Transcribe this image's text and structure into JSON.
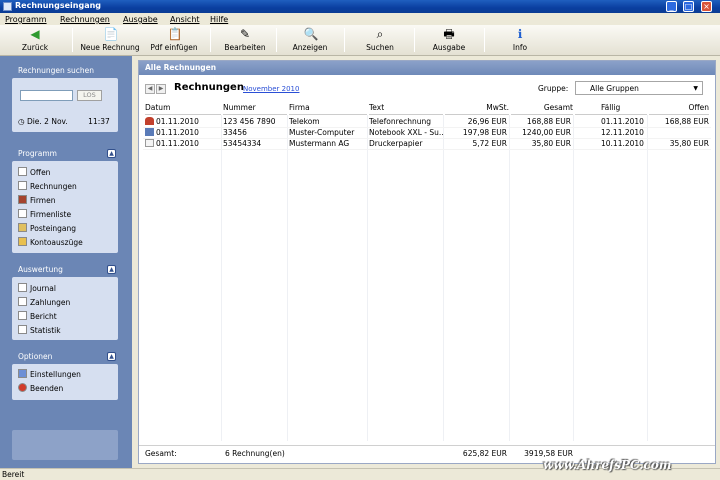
{
  "window": {
    "title": "Rechnungseingang",
    "min": "_",
    "max": "□",
    "close": "×"
  },
  "menu": [
    "Programm",
    "Rechnungen",
    "Ausgabe",
    "Ansicht",
    "Hilfe"
  ],
  "toolbar": [
    {
      "label": "Zurück",
      "icon": "back-arrow-icon",
      "glyph": "◀"
    },
    {
      "label": "Neue Rechnung",
      "icon": "new-invoice-icon",
      "glyph": "📄"
    },
    {
      "label": "Pdf einfügen",
      "icon": "paste-pdf-icon",
      "glyph": "📋"
    },
    {
      "label": "Bearbeiten",
      "icon": "edit-icon",
      "glyph": "✎"
    },
    {
      "label": "Anzeigen",
      "icon": "view-icon",
      "glyph": "🔍"
    },
    {
      "label": "Suchen",
      "icon": "search-icon",
      "glyph": "⌕"
    },
    {
      "label": "Ausgabe",
      "icon": "printer-icon",
      "glyph": "🖶"
    },
    {
      "label": "Info",
      "icon": "info-icon",
      "glyph": "ℹ"
    }
  ],
  "sidebar": {
    "search": {
      "title": "Rechnungen suchen",
      "button": "LOS",
      "date": "Die. 2 Nov.",
      "time": "11:37"
    },
    "programm": {
      "title": "Programm",
      "items": [
        "Offen",
        "Rechnungen",
        "Firmen",
        "Firmenliste",
        "Posteingang",
        "Kontoauszüge"
      ]
    },
    "auswertung": {
      "title": "Auswertung",
      "items": [
        "Journal",
        "Zahlungen",
        "Bericht",
        "Statistik"
      ]
    },
    "optionen": {
      "title": "Optionen",
      "items": [
        "Einstellungen",
        "Beenden"
      ]
    }
  },
  "main": {
    "header": "Alle Rechnungen",
    "list_title": "Rechnungen",
    "month": "November 2010",
    "group_label": "Gruppe:",
    "group_value": "Alle Gruppen",
    "columns": [
      "Datum",
      "Nummer",
      "Firma",
      "Text",
      "MwSt.",
      "Gesamt",
      "Fällig",
      "Offen"
    ],
    "rows": [
      [
        "01.11.2010",
        "123 456 7890",
        "Telekom",
        "Telefonrechnung",
        "26,96 EUR",
        "168,88 EUR",
        "01.11.2010",
        "168,88 EUR"
      ],
      [
        "01.11.2010",
        "33456",
        "Muster-Computer",
        "Notebook XXL - Su...",
        "197,98 EUR",
        "1240,00 EUR",
        "12.11.2010",
        ""
      ],
      [
        "01.11.2010",
        "53454334",
        "Mustermann AG",
        "Druckerpapier",
        "5,72 EUR",
        "35,80 EUR",
        "10.11.2010",
        "35,80 EUR"
      ]
    ],
    "totals": {
      "label": "Gesamt:",
      "count": "6 Rechnung(en)",
      "mwst": "625,82 EUR",
      "gesamt": "3919,58 EUR"
    }
  },
  "status": "Bereit",
  "watermark": "www.AhrefsPC.com",
  "colors": {
    "sidebar": "#6b86b5",
    "titlebar": "#0a3fa0",
    "link": "#2a4fd6"
  }
}
